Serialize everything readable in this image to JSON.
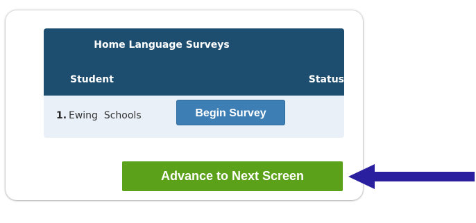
{
  "survey_table": {
    "title": "Home Language Surveys",
    "columns": {
      "student": "Student",
      "status": "Status"
    },
    "rows": [
      {
        "number": "1.",
        "name": "Ewing  Schools",
        "action_label": "Begin Survey"
      }
    ]
  },
  "advance_button": {
    "label": "Advance to Next Screen"
  },
  "colors": {
    "header_bg": "#1d4d6f",
    "row_bg": "#e9f0f8",
    "begin_button": "#3d7eb5",
    "advance_button": "#5ba11a",
    "arrow": "#2a1f9e"
  },
  "icons": {
    "pointer": "left-arrow-icon"
  }
}
